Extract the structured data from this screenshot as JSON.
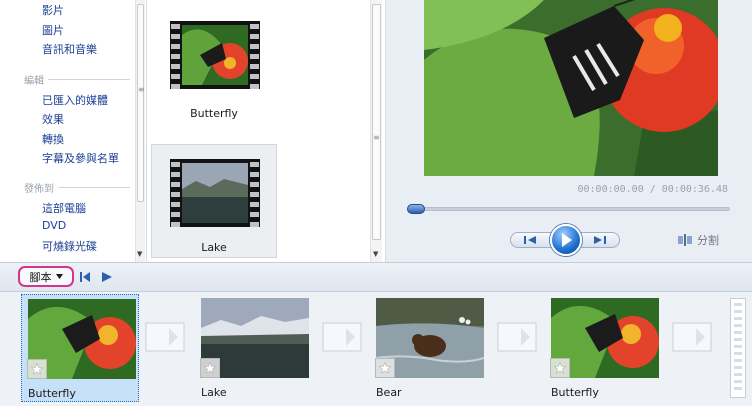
{
  "task_pane": {
    "import_links": [
      "影片",
      "圖片",
      "音訊和音樂"
    ],
    "edit_group": "編輯",
    "edit_links": [
      "已匯入的媒體",
      "效果",
      "轉換",
      "字幕及參與名單"
    ],
    "publish_group": "發佈到",
    "publish_links": [
      "這部電腦",
      "DVD",
      "可燒錄光碟"
    ]
  },
  "media_list": {
    "items": [
      {
        "name": "Butterfly",
        "selected": false
      },
      {
        "name": "Lake",
        "selected": true
      }
    ]
  },
  "preview": {
    "timecode": "00:00:00.00 / 00:00:36.48",
    "position_fraction": 0.0,
    "split_label": "分割"
  },
  "toolbar": {
    "view_dropdown_label": "腳本",
    "icons": [
      "dropdown-arrow-icon",
      "go-to-start-icon",
      "play-storyboard-icon"
    ]
  },
  "storyboard": {
    "clips": [
      {
        "name": "Butterfly",
        "selected": true
      },
      {
        "name": "Lake",
        "selected": false
      },
      {
        "name": "Bear",
        "selected": false
      },
      {
        "name": "Butterfly",
        "selected": false
      }
    ]
  },
  "colors": {
    "link": "#1c3f95",
    "accent_blue": "#1e6fd0",
    "highlight_ring": "#d0368c",
    "storyboard_bg": "#eef2f7",
    "selected_clip": "#c6e0f8"
  }
}
